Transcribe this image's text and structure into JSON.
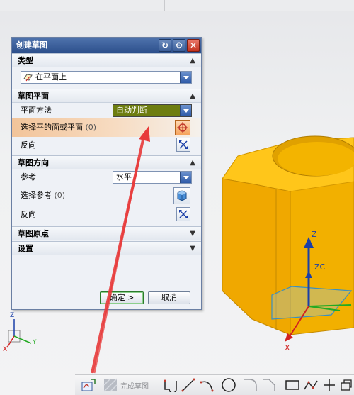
{
  "dialog": {
    "title": "创建草图",
    "sections": {
      "type": "类型",
      "sketch_plane": "草图平面",
      "sketch_orientation": "草图方向",
      "sketch_origin": "草图原点",
      "settings": "设置"
    },
    "type_value": "在平面上",
    "plane_method_label": "平面方法",
    "plane_method_value": "自动判断",
    "select_plane_label": "选择平的面或平面",
    "select_plane_count": "(0)",
    "reverse_label": "反向",
    "reference_label": "参考",
    "reference_value": "水平",
    "select_reference_label": "选择参考",
    "select_reference_count": "(0)",
    "reverse_label_2": "反向",
    "ok_label": "确定 >",
    "cancel_label": "取消"
  },
  "viewport": {
    "axis_z": "Z",
    "axis_zc": "ZC",
    "axis_x": "X",
    "triad_z": "Z",
    "triad_x": "X",
    "triad_y": "Y"
  },
  "toolbar": {
    "finish_sketch_label": "完成草图"
  },
  "colors": {
    "part_face": "#f2b000",
    "part_top": "#ffc61a",
    "title_bar": "#2c4f8b",
    "plane_method_bg": "#6d7d10",
    "annotation_arrow": "#e83a3a"
  },
  "icons": [
    "reset-icon",
    "settings-icon",
    "close-icon",
    "plane-icon",
    "crosshair-icon",
    "reverse-direction-icon",
    "select-reference-icon",
    "finish-sketch-icon",
    "profile-icon",
    "line-icon",
    "arc-icon",
    "circle-icon",
    "fillet-icon",
    "rectangle-icon",
    "polyline-icon",
    "point-icon"
  ]
}
